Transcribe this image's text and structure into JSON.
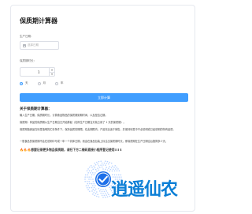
{
  "title": "保质期计算器",
  "form": {
    "date_label": "生产日期：",
    "date_placeholder": "选择日期",
    "shelf_label": "保质期时长：",
    "shelf_value": "1",
    "step_up": "▲",
    "step_down": "▼",
    "units": [
      {
        "label": "天",
        "selected": true
      },
      {
        "label": "月",
        "selected": false
      },
      {
        "label": "年",
        "selected": false
      }
    ],
    "calc_button": "立即计算"
  },
  "about": {
    "heading": "关于保质期计算器：",
    "paragraphs": [
      "输入生产日期，保质期时长，计算食品物品的保质期到期时间，以及是否过期。",
      "保质期：商品的保质期从生产日期当日开始算起（也即生产日期当天就占用了 1 天的保质期）。",
      "保质期指食品在标签指明的贮存条件下，保持品质的期限。在此期限内，产品完全适于销售，并保持标签中不必说明或已经说明的特有品质。",
      "一般食品的保质期不会在说明中写成一年一个具体日期，而会在食品包装上标注出保质期时长，即保质期在生产日期往后推算多少天。"
    ],
    "promo": "🔥🔥🔥想要记录更多物品保质期，请扫下方二维码直接小程序登记使用⬇⬇⬇"
  },
  "watermark": "逍遥仙农",
  "colors": {
    "accent": "#409eff",
    "watermark": "#0c7fd6"
  }
}
